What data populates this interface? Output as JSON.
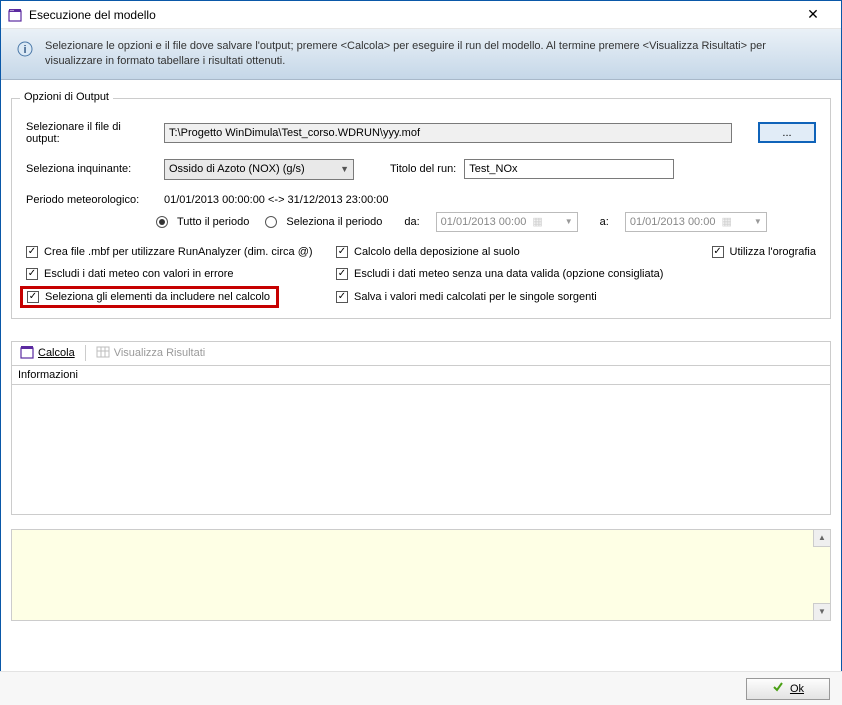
{
  "window": {
    "title": "Esecuzione del modello"
  },
  "banner": {
    "text": "Selezionare le opzioni e il file dove salvare l'output; premere <Calcola> per eseguire il run del modello. Al termine premere <Visualizza Risultati> per visualizzare in formato tabellare i risultati ottenuti."
  },
  "group": {
    "title": "Opzioni di Output",
    "output_file_label": "Selezionare il file di output:",
    "output_file_value": "T:\\Progetto WinDimula\\Test_corso.WDRUN\\yyy.mof",
    "browse_label": "...",
    "pollutant_label": "Seleziona inquinante:",
    "pollutant_selected": "Ossido di Azoto (NOX) (g/s)",
    "run_title_label": "Titolo del run:",
    "run_title_value": "Test_NOx",
    "period_label": "Periodo meteorologico:",
    "period_value": "01/01/2013 00:00:00 <-> 31/12/2013 23:00:00",
    "radio_all": "Tutto il periodo",
    "radio_sel": "Seleziona il periodo",
    "from_label": "da:",
    "from_value": "01/01/2013 00:00",
    "to_label": "a:",
    "to_value": "01/01/2013 00:00",
    "checks": {
      "mbf": "Crea file .mbf per utilizzare RunAnalyzer (dim. circa @)",
      "deposition": "Calcolo della deposizione al suolo",
      "orography": "Utilizza l'orografia",
      "exclude_err": "Escludi i dati meteo con valori in errore",
      "exclude_invalid": "Escludi i dati meteo senza una data valida (opzione consigliata)",
      "select_elements": "Seleziona gli elementi da includere nel calcolo",
      "save_avg": "Salva i valori medi calcolati per le singole sorgenti"
    }
  },
  "toolbar": {
    "calc_label": "Calcola",
    "results_label": "Visualizza Risultati"
  },
  "info_panel_title": "Informazioni",
  "ok_label": "Ok"
}
